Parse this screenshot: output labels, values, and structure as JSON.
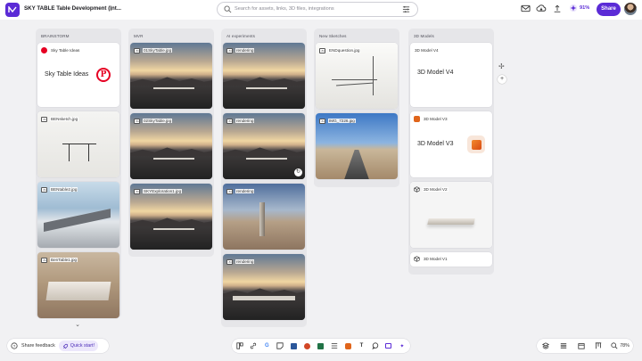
{
  "header": {
    "board_title": "SKY TABLE Table Development (Int...",
    "search_placeholder": "Search for assets, links, 3D files, integrations",
    "usage_percent": "91%",
    "share_label": "Share"
  },
  "columns": [
    {
      "title": "BRAINSTORM",
      "cards": [
        {
          "label": "Sky Table Ideas",
          "content": "Sky Table Ideas",
          "logo": "P"
        },
        {
          "label": "BENsketch.jpg"
        },
        {
          "label": "BENtable2.jpg"
        },
        {
          "label": "BenTable1.jpg"
        }
      ]
    },
    {
      "title": "MVR",
      "cards": [
        {
          "label": "01SkyTable.jpg"
        },
        {
          "label": "02SkyTable.jpg"
        },
        {
          "label": "SKYExploration1.jpg"
        }
      ]
    },
    {
      "title": "AI experiments",
      "cards": [
        {
          "label": "rendering"
        },
        {
          "label": "rendering"
        },
        {
          "label": "rendering"
        },
        {
          "label": "rendering"
        }
      ]
    },
    {
      "title": "New Sketches",
      "cards": [
        {
          "label": "ENDquestion.jpg"
        },
        {
          "label": "IMG_7226.jpg"
        }
      ]
    },
    {
      "title": "3D Models",
      "cards": [
        {
          "label": "3D Model V4",
          "content": "3D Model V4"
        },
        {
          "label": "3D Model V3",
          "content": "3D Model V3"
        },
        {
          "label": "3D Model V2"
        },
        {
          "label": "3D Model V1"
        }
      ]
    }
  ],
  "bottom": {
    "share_feedback": "Share feedback",
    "quick_start": "Quick start!",
    "zoom": "78%"
  },
  "colors": {
    "accent": "#5b2bd6",
    "pinterest": "#e60023",
    "canvas": "#f1f1f3"
  }
}
